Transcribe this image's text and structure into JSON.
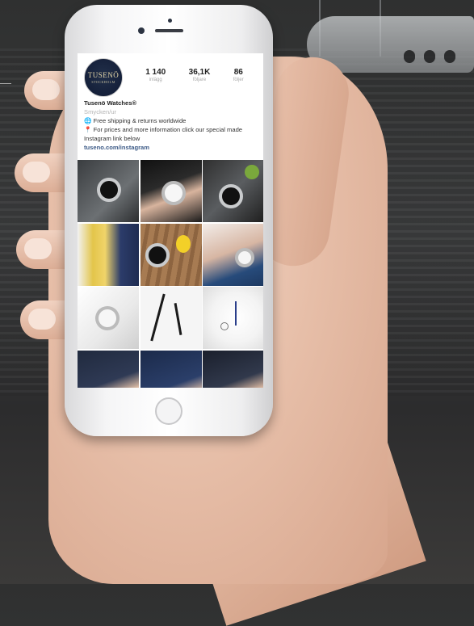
{
  "profile": {
    "avatar_text": "TUSENÖ",
    "avatar_subtext": "STOCKHOLM",
    "name": "Tusenö Watches®",
    "category": "Smycken/ur",
    "bio_line1": "Free shipping & returns worldwide",
    "bio_line2": "For prices and more information click our special made Instagram link below",
    "link": "tuseno.com/instagram"
  },
  "stats": [
    {
      "value": "1 140",
      "label": "inlägg"
    },
    {
      "value": "36,1K",
      "label": "följare"
    },
    {
      "value": "86",
      "label": "följer"
    }
  ],
  "colors": {
    "link": "#3c5a86",
    "avatar_bg": "#15203a"
  },
  "grid_tiles": [
    "watch-dark-dial-on-rock",
    "hands-holding-watch",
    "watch-on-leather",
    "yellow-scarf-wrist",
    "watch-on-wooden-table",
    "watch-on-shirt-wrist",
    "white-watch-on-tissue",
    "watch-hands-silhouettes",
    "white-dial-chronograph",
    "suit-wrist-watch",
    "navy-sleeve-watch",
    "formal-cuff-watch"
  ]
}
